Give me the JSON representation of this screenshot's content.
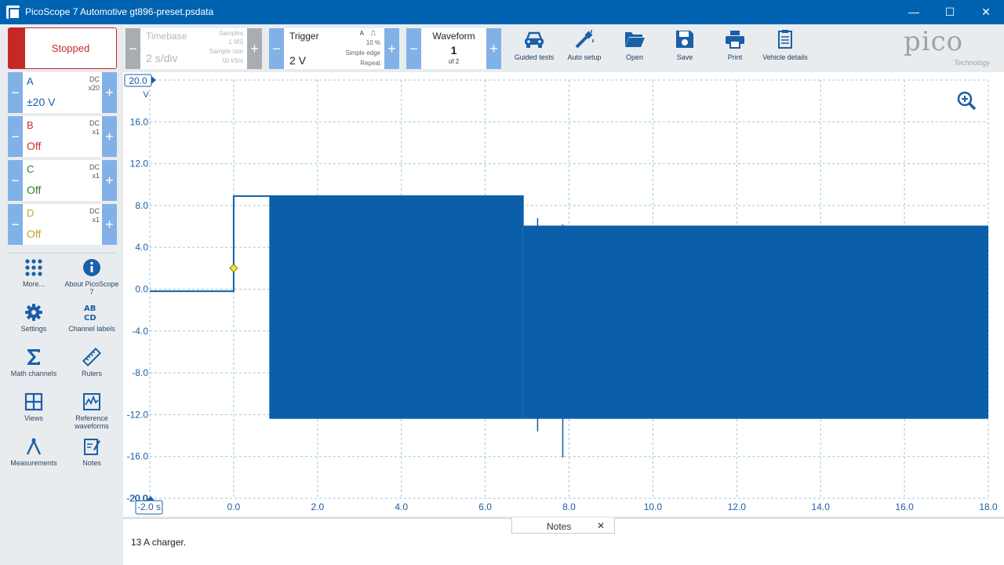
{
  "window": {
    "title": "PicoScope 7 Automotive gt896-preset.psdata",
    "minimize": "—",
    "maximize": "☐",
    "close": "✕"
  },
  "run": {
    "label": "Stopped",
    "color": "#c62828"
  },
  "channels": [
    {
      "name": "A",
      "coupling": "DC",
      "probe": "x20",
      "range": "±20 V",
      "color": "#1a5fa8"
    },
    {
      "name": "B",
      "coupling": "DC",
      "probe": "x1",
      "range": "Off",
      "color": "#d32f2f"
    },
    {
      "name": "C",
      "coupling": "DC",
      "probe": "x1",
      "range": "Off",
      "color": "#2e7d32"
    },
    {
      "name": "D",
      "coupling": "DC",
      "probe": "x1",
      "range": "Off",
      "color": "#c9a227"
    }
  ],
  "tools": [
    {
      "label": "More...",
      "icon": "dots-grid-icon"
    },
    {
      "label": "About PicoScope 7",
      "icon": "info-icon"
    },
    {
      "label": "Settings",
      "icon": "gear-icon"
    },
    {
      "label": "Channel labels",
      "icon": "abcd-icon"
    },
    {
      "label": "Math channels",
      "icon": "sigma-icon"
    },
    {
      "label": "Rulers",
      "icon": "ruler-icon"
    },
    {
      "label": "Views",
      "icon": "grid-views-icon"
    },
    {
      "label": "Reference waveforms",
      "icon": "reference-waveform-icon"
    },
    {
      "label": "Measurements",
      "icon": "compass-icon"
    },
    {
      "label": "Notes",
      "icon": "notepad-icon"
    }
  ],
  "timebase": {
    "label": "Timebase",
    "value": "2 s/div",
    "samples_label": "Samples",
    "samples_value": "1 MS",
    "rate_label": "Sample rate",
    "rate_value": "50 kS/s"
  },
  "trigger": {
    "label": "Trigger",
    "value": "2 V",
    "channel": "A",
    "edge_symbol": "⎍",
    "pretrigger": "10 %",
    "type": "Simple edge",
    "mode": "Repeat"
  },
  "waveform": {
    "label": "Waveform",
    "index": "1",
    "of": "of 2"
  },
  "toolbar_buttons": [
    {
      "label": "Guided tests",
      "icon": "car-icon"
    },
    {
      "label": "Auto setup",
      "icon": "magic-wand-icon"
    },
    {
      "label": "Open",
      "icon": "folder-open-icon"
    },
    {
      "label": "Save",
      "icon": "floppy-disk-icon"
    },
    {
      "label": "Print",
      "icon": "printer-icon"
    },
    {
      "label": "Vehicle details",
      "icon": "clipboard-icon"
    }
  ],
  "logo": {
    "word": "pico",
    "sub": "Technology"
  },
  "chart_data": {
    "type": "line",
    "title": "",
    "xlabel": "s",
    "ylabel": "V",
    "xlim": [
      -2.0,
      18.0
    ],
    "ylim": [
      -20.0,
      20.0
    ],
    "x_ticks": [
      "-2.0",
      "0.0",
      "2.0",
      "4.0",
      "6.0",
      "8.0",
      "10.0",
      "12.0",
      "14.0",
      "16.0",
      "18.0"
    ],
    "y_ticks": [
      "20.0",
      "16.0",
      "12.0",
      "8.0",
      "4.0",
      "0.0",
      "-4.0",
      "-8.0",
      "-12.0",
      "-16.0",
      "-20.0"
    ],
    "y_top_label": "20.0",
    "y_unit": "V",
    "x_first_label": "-2.0 s",
    "grid": true,
    "trigger_point": {
      "x": 0.0,
      "y": 2.0
    },
    "series": [
      {
        "name": "A",
        "color": "#0a5fa8",
        "x": [
          -2.0,
          0.0,
          0.0,
          0.85,
          0.85,
          6.9,
          6.9,
          18.0
        ],
        "y": [
          -0.2,
          -0.2,
          8.9,
          8.9,
          8.9,
          8.9,
          6.0,
          6.0
        ],
        "envelope": [
          {
            "x0": 0.85,
            "x1": 6.9,
            "max": 8.9,
            "min": -12.4
          },
          {
            "x0": 6.9,
            "x1": 18.0,
            "max": 6.0,
            "min": -12.4
          }
        ],
        "spikes": [
          {
            "x": 7.25,
            "max": 6.8,
            "min": -13.6
          },
          {
            "x": 7.85,
            "max": 6.2,
            "min": -16.1
          }
        ]
      }
    ]
  },
  "notes": {
    "tab": "Notes",
    "close": "✕",
    "text": "13 A charger."
  }
}
